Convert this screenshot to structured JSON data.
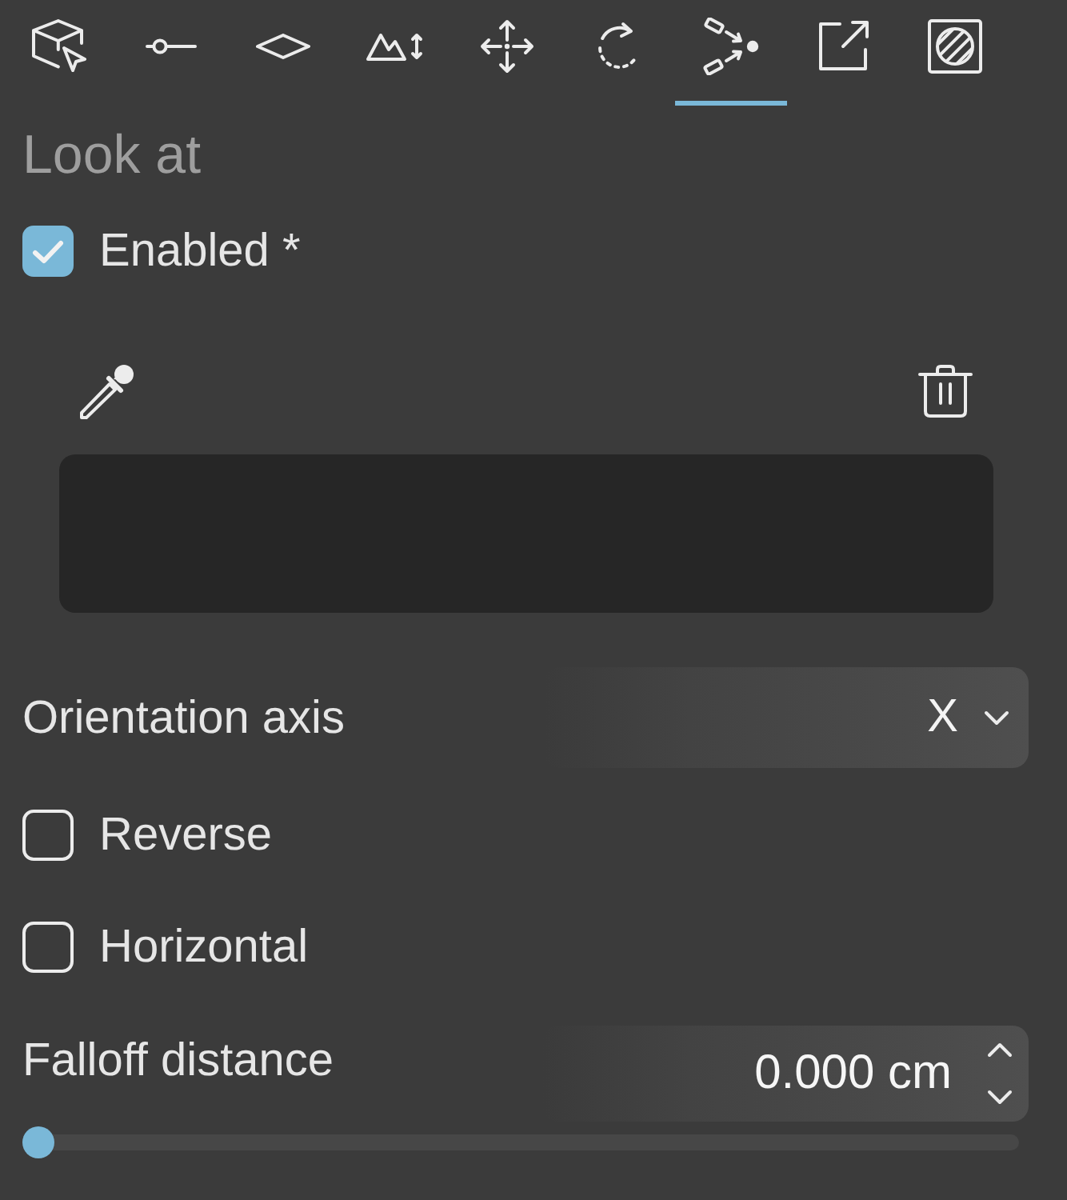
{
  "toolbar": {
    "tabs": [
      {
        "kind": "cube-cursor",
        "selected": false
      },
      {
        "kind": "circle-line",
        "selected": false
      },
      {
        "kind": "diamond",
        "selected": false
      },
      {
        "kind": "mountain-arrow",
        "selected": false
      },
      {
        "kind": "move",
        "selected": false
      },
      {
        "kind": "dashed-rotate",
        "selected": false
      },
      {
        "kind": "arrows-to-dot",
        "selected": true
      },
      {
        "kind": "box-arrow",
        "selected": false
      },
      {
        "kind": "hatched-circle",
        "selected": false
      }
    ]
  },
  "section": {
    "title": "Look at"
  },
  "enabled": {
    "label": "Enabled *",
    "checked": true
  },
  "orientation_axis": {
    "label": "Orientation axis",
    "value": "X"
  },
  "options": [
    {
      "label": "Reverse",
      "checked": false
    },
    {
      "label": "Horizontal",
      "checked": false
    }
  ],
  "falloff_distance": {
    "label": "Falloff distance",
    "value": "0.000 cm",
    "level": 0
  }
}
